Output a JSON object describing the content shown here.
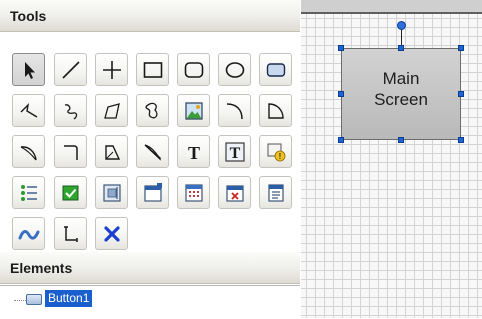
{
  "tools_panel": {
    "title": "Tools",
    "tools": [
      {
        "id": "pointer-icon",
        "selected": true
      },
      {
        "id": "line-icon"
      },
      {
        "id": "crosshair-icon"
      },
      {
        "id": "rectangle-icon"
      },
      {
        "id": "rounded-rectangle-icon"
      },
      {
        "id": "ellipse-icon"
      },
      {
        "id": "rounded-box-icon"
      },
      {
        "id": "polyline-icon"
      },
      {
        "id": "freehand-curve-icon"
      },
      {
        "id": "polygon-icon"
      },
      {
        "id": "closed-curve-icon"
      },
      {
        "id": "picture-icon"
      },
      {
        "id": "arc-icon"
      },
      {
        "id": "arc-shape-icon"
      },
      {
        "id": "curved-connector-icon"
      },
      {
        "id": "elbow-connector-icon"
      },
      {
        "id": "curved-shape-icon"
      },
      {
        "id": "bezier-icon"
      },
      {
        "id": "text-icon",
        "label": "T"
      },
      {
        "id": "textbox-icon",
        "label": "T"
      },
      {
        "id": "tooltip-icon"
      },
      {
        "id": "list-icon"
      },
      {
        "id": "checkbox-icon"
      },
      {
        "id": "image-frame-icon"
      },
      {
        "id": "window-icon"
      },
      {
        "id": "calendar-icon"
      },
      {
        "id": "dialog-icon"
      },
      {
        "id": "form-icon"
      },
      {
        "id": "wave-icon"
      },
      {
        "id": "step-connector-icon"
      },
      {
        "id": "delete-icon"
      }
    ]
  },
  "elements_panel": {
    "title": "Elements",
    "items": [
      {
        "label": "Button1",
        "selected": true
      }
    ]
  },
  "canvas": {
    "shape_label_line1": "Main",
    "shape_label_line2": "Screen"
  },
  "colors": {
    "accent_blue": "#1f63d6",
    "selection": "#1a5fce",
    "delete_red": "#1c3fcf"
  }
}
